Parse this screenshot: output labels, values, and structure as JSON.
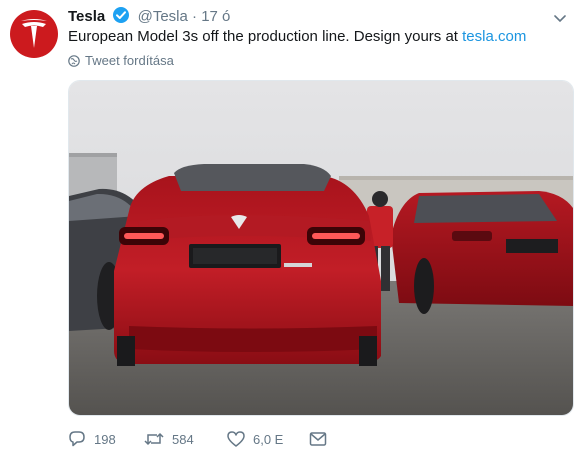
{
  "tweet": {
    "author_name": "Tesla",
    "handle": "@Tesla",
    "separator": "·",
    "time": "17 ó",
    "text_main": "European Model 3s off the production line. Design yours at ",
    "text_link": "tesla.com",
    "translate_label": "Tweet fordítása"
  },
  "actions": {
    "reply_count": "198",
    "retweet_count": "584",
    "like_count": "6,0 E"
  },
  "colors": {
    "brand_red": "#cc1a1e",
    "link_blue": "#1b95e0",
    "verified_blue": "#1da1f2",
    "muted_gray": "#657786"
  },
  "icons": [
    "tesla-logo-icon",
    "verified-badge-icon",
    "chevron-down-icon",
    "globe-icon",
    "reply-icon",
    "retweet-icon",
    "like-icon",
    "message-icon"
  ]
}
